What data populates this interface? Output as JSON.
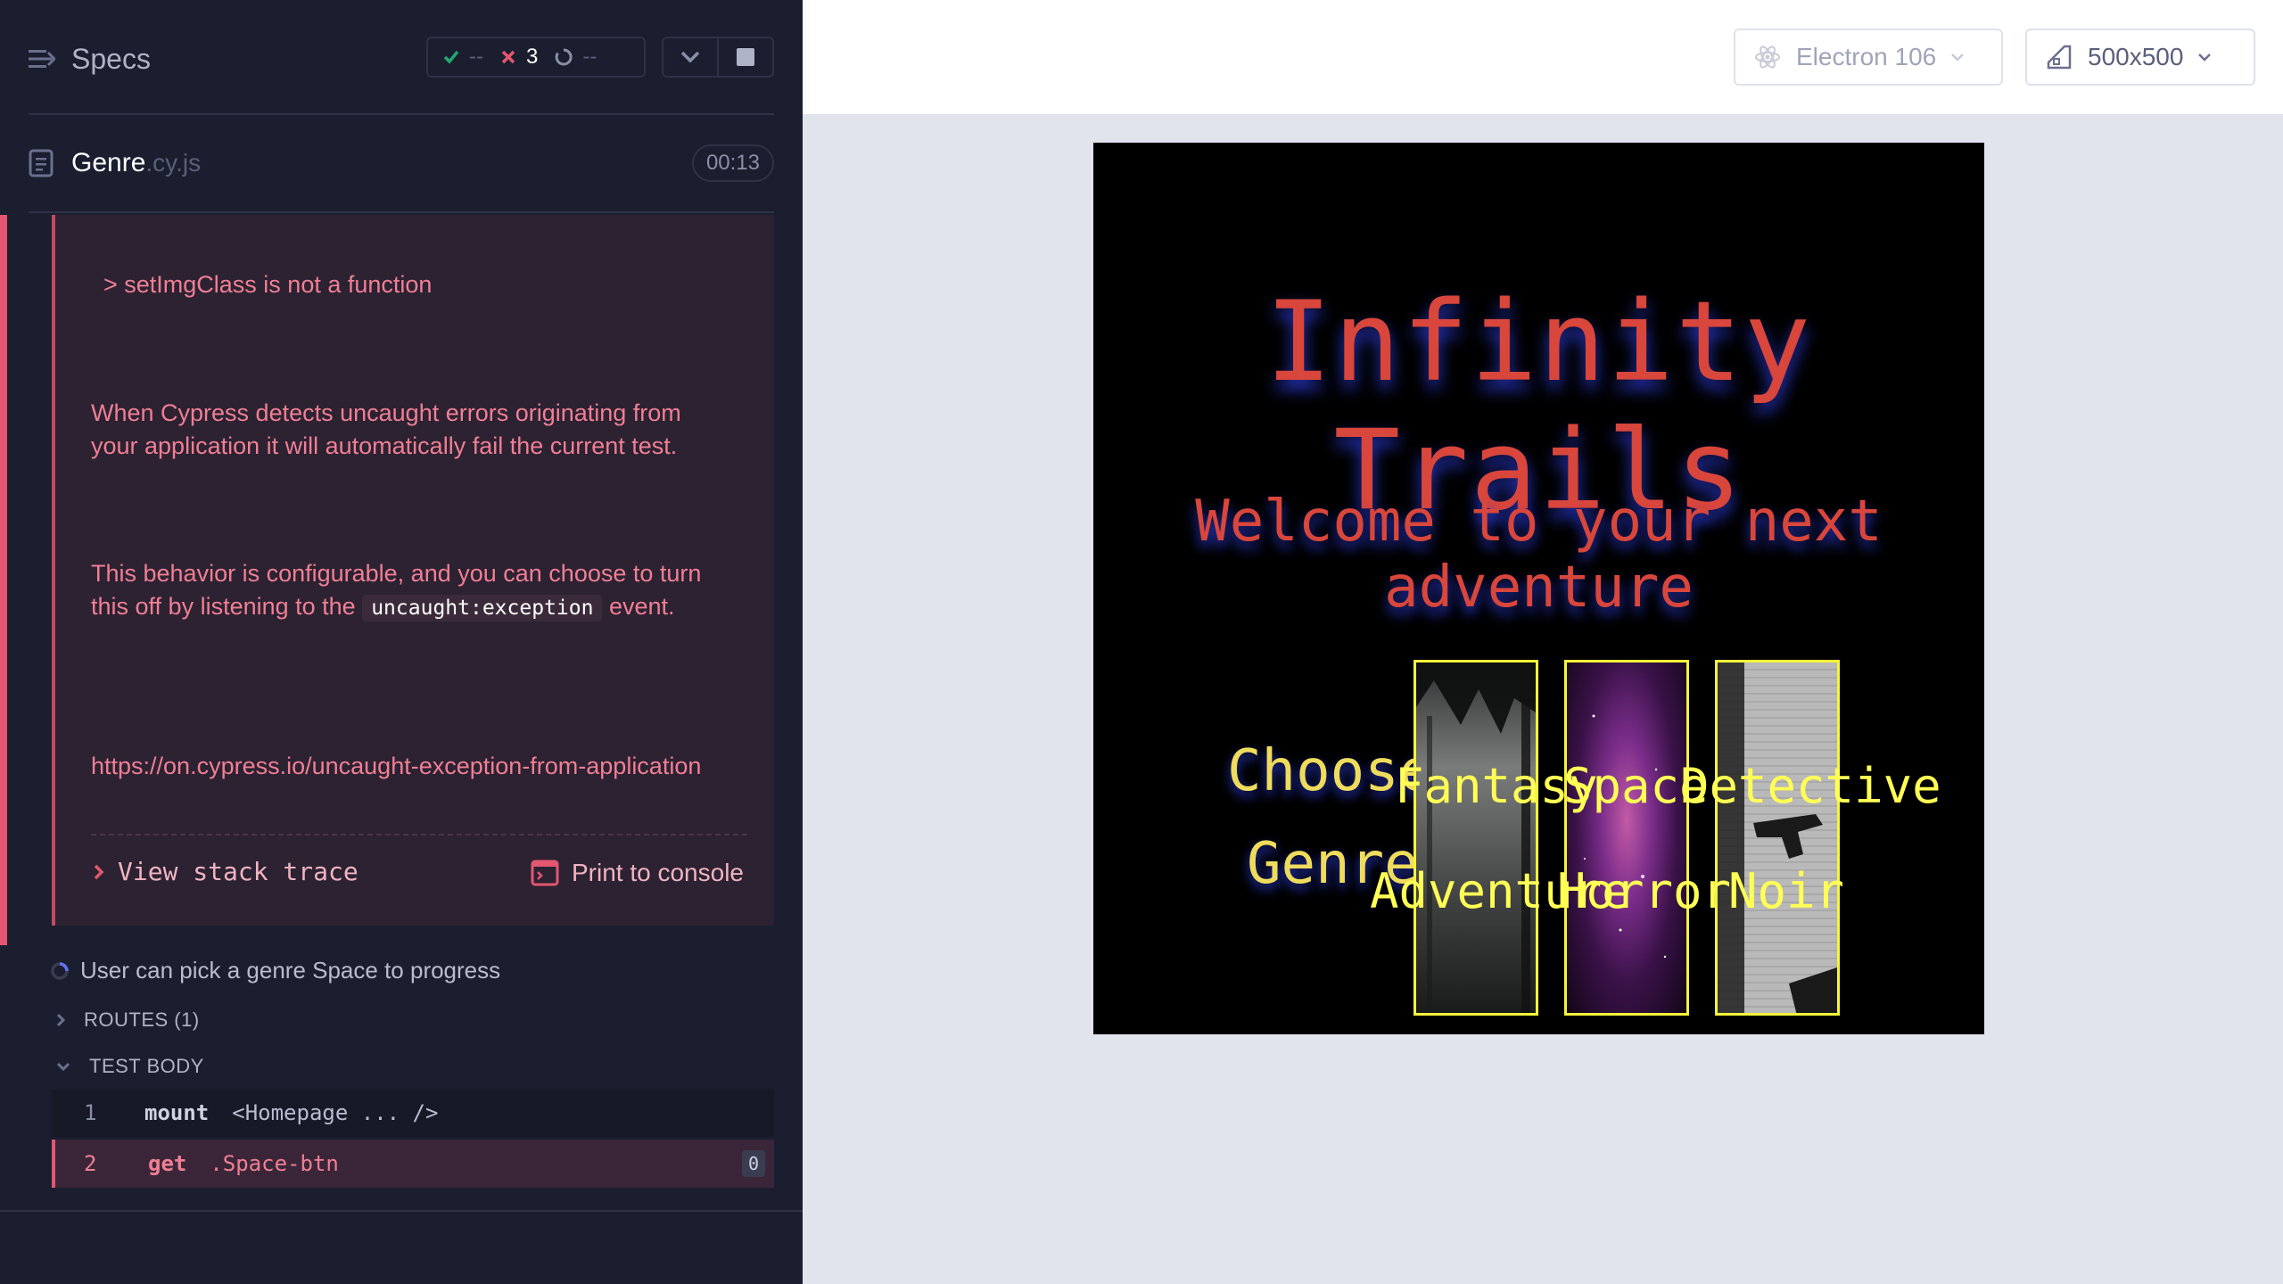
{
  "reporter": {
    "specs_label": "Specs",
    "stats": {
      "passed": "--",
      "failed": "3",
      "pending": "--"
    },
    "spec": {
      "name": "Genre",
      "ext": ".cy.js",
      "duration": "00:13"
    },
    "error": {
      "message": "> setImgClass is not a function",
      "para1": "When Cypress detects uncaught errors originating from your application it will automatically fail the current test.",
      "para2_before": "This behavior is configurable, and you can choose to turn this off by listening to the",
      "para2_code": "uncaught:exception",
      "para2_after": "event.",
      "link": "https://on.cypress.io/uncaught-exception-from-application",
      "stack_label": "View stack trace",
      "print_label": "Print to console"
    },
    "test": {
      "title": "User can pick a genre Space to progress",
      "routes_label": "ROUTES (1)",
      "body_label": "TEST BODY",
      "commands": [
        {
          "num": "1",
          "name": "mount",
          "message": "<Homepage ... />"
        },
        {
          "num": "2",
          "name": "get",
          "message": ".Space-btn",
          "badge": "0"
        }
      ]
    }
  },
  "topbar": {
    "browser": "Electron 106",
    "viewport": "500x500"
  },
  "app": {
    "title": "Infinity Trails",
    "subtitle": "Welcome to your next adventure",
    "choose_line1": "Choose",
    "choose_line2": "Genre",
    "genres": [
      {
        "line1": "Fantasy",
        "line2": "Adventure"
      },
      {
        "line1": "Space",
        "line2": "Horror"
      },
      {
        "line1": "Detective",
        "line2": "Noir"
      }
    ]
  },
  "colors": {
    "fail": "#e45770",
    "accent_yellow": "#f5f53a",
    "title_red": "#d9463b"
  }
}
